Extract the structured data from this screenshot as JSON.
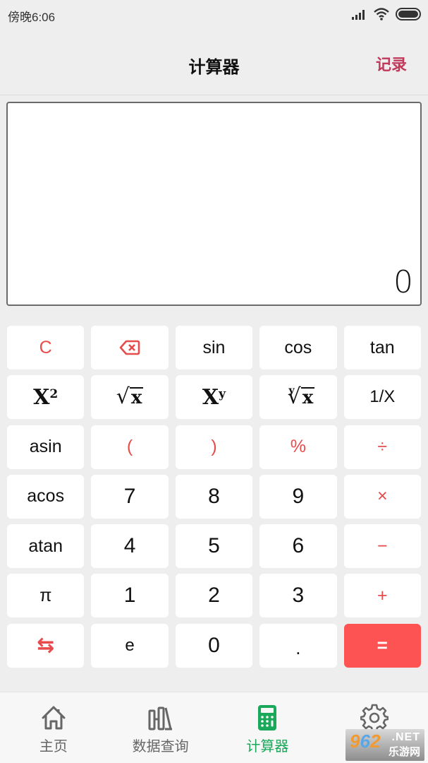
{
  "status_bar": {
    "time": "傍晚6:06",
    "icons": [
      "signal-icon",
      "wifi-icon",
      "battery-icon"
    ]
  },
  "app_bar": {
    "title": "计算器",
    "history_label": "记录"
  },
  "display": {
    "expression": "",
    "value": "0"
  },
  "keypad": {
    "rows": [
      [
        {
          "label": "C",
          "name": "clear-key",
          "style": "red"
        },
        {
          "label": "",
          "name": "backspace-key",
          "style": "red",
          "icon": "backspace-icon"
        },
        {
          "label": "sin",
          "name": "sin-key"
        },
        {
          "label": "cos",
          "name": "cos-key"
        },
        {
          "label": "tan",
          "name": "tan-key"
        }
      ],
      [
        {
          "label": "X",
          "sup": "2",
          "name": "square-key",
          "style": "math"
        },
        {
          "label": "x",
          "name": "sqrt-key",
          "style": "sqrt"
        },
        {
          "label": "X",
          "sup": "y",
          "name": "power-key",
          "style": "math"
        },
        {
          "label": "x",
          "index": "y",
          "name": "nth-root-key",
          "style": "sqrt"
        },
        {
          "label": "1/X",
          "name": "reciprocal-key"
        }
      ],
      [
        {
          "label": "asin",
          "name": "asin-key"
        },
        {
          "label": "(",
          "name": "open-paren-key",
          "style": "red"
        },
        {
          "label": ")",
          "name": "close-paren-key",
          "style": "red"
        },
        {
          "label": "%",
          "name": "percent-key",
          "style": "red"
        },
        {
          "label": "÷",
          "name": "divide-key",
          "style": "red"
        }
      ],
      [
        {
          "label": "acos",
          "name": "acos-key"
        },
        {
          "label": "7",
          "name": "digit-7-key",
          "style": "num"
        },
        {
          "label": "8",
          "name": "digit-8-key",
          "style": "num"
        },
        {
          "label": "9",
          "name": "digit-9-key",
          "style": "num"
        },
        {
          "label": "×",
          "name": "multiply-key",
          "style": "red"
        }
      ],
      [
        {
          "label": "atan",
          "name": "atan-key"
        },
        {
          "label": "4",
          "name": "digit-4-key",
          "style": "num"
        },
        {
          "label": "5",
          "name": "digit-5-key",
          "style": "num"
        },
        {
          "label": "6",
          "name": "digit-6-key",
          "style": "num"
        },
        {
          "label": "−",
          "name": "subtract-key",
          "style": "red"
        }
      ],
      [
        {
          "label": "π",
          "name": "pi-key"
        },
        {
          "label": "1",
          "name": "digit-1-key",
          "style": "num"
        },
        {
          "label": "2",
          "name": "digit-2-key",
          "style": "num"
        },
        {
          "label": "3",
          "name": "digit-3-key",
          "style": "num"
        },
        {
          "label": "+",
          "name": "add-key",
          "style": "red"
        }
      ],
      [
        {
          "label": "⇆",
          "name": "swap-key",
          "style": "red"
        },
        {
          "label": "e",
          "name": "euler-key"
        },
        {
          "label": "0",
          "name": "digit-0-key",
          "style": "num"
        },
        {
          "label": ".",
          "name": "decimal-key"
        },
        {
          "label": "=",
          "name": "equals-key",
          "style": "equals"
        }
      ]
    ]
  },
  "bottom_nav": {
    "items": [
      {
        "label": "主页",
        "icon": "home-icon",
        "active": false
      },
      {
        "label": "数据查询",
        "icon": "books-icon",
        "active": false
      },
      {
        "label": "计算器",
        "icon": "calculator-icon",
        "active": true
      },
      {
        "label": "设置",
        "icon": "gear-icon",
        "active": false
      }
    ]
  },
  "watermark": {
    "number": "962",
    "net": ".NET",
    "cn": "乐游网"
  },
  "colors": {
    "accent_red": "#e84b4b",
    "equals_bg": "#fe5353",
    "active_nav": "#1aa85a",
    "history": "#c0395a"
  }
}
